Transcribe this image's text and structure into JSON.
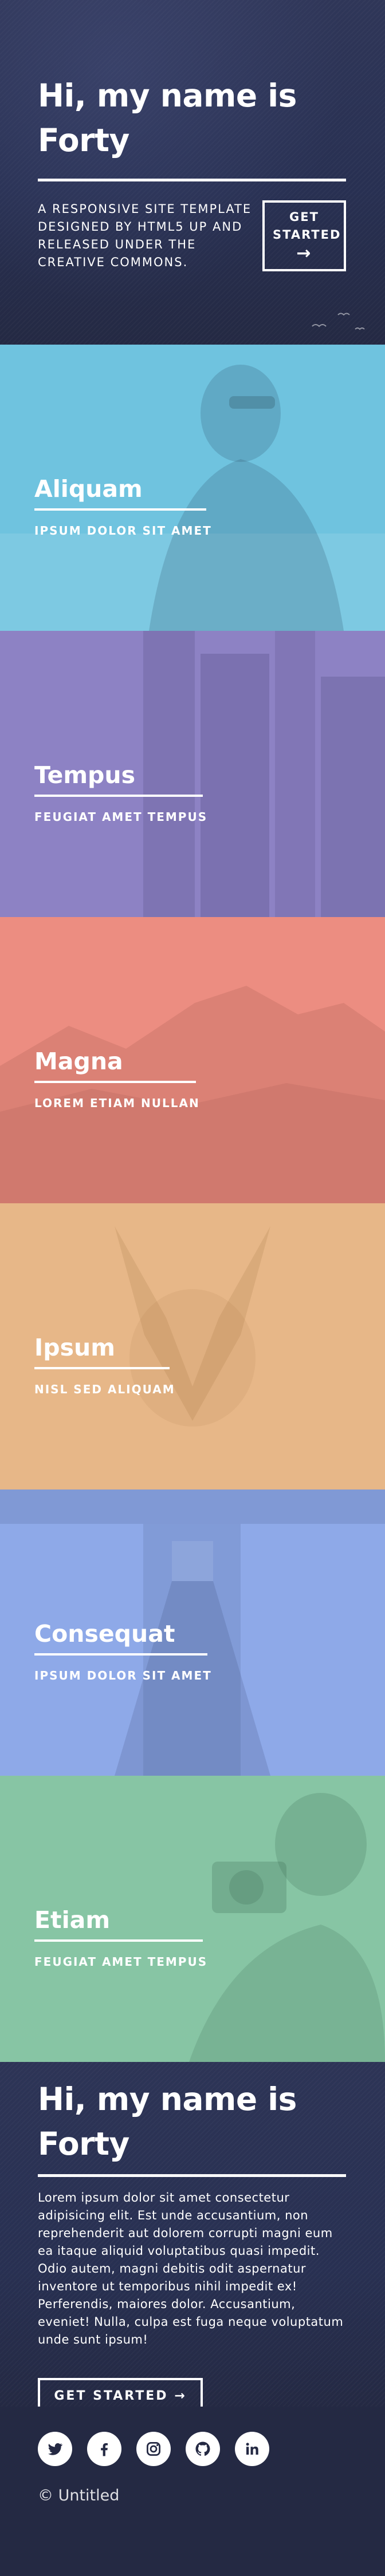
{
  "banner": {
    "title": "Hi, my name is Forty",
    "description": "A responsive site template designed by HTML5 UP and released under the Creative Commons.",
    "button_label": "GET STARTED",
    "button_arrow": "→"
  },
  "tiles": [
    {
      "title": "Aliquam",
      "subtitle": "IPSUM DOLOR SIT AMET",
      "color": "#6fc3df"
    },
    {
      "title": "Tempus",
      "subtitle": "FEUGIAT AMET TEMPUS",
      "color": "#8d82c4"
    },
    {
      "title": "Magna",
      "subtitle": "LOREM ETIAM NULLAN",
      "color": "#ec8d81"
    },
    {
      "title": "Ipsum",
      "subtitle": "NISL SED ALIQUAM",
      "color": "#e7b788"
    },
    {
      "title": "Consequat",
      "subtitle": "IPSUM DOLOR SIT AMET",
      "color": "#8ea9e8"
    },
    {
      "title": "Etiam",
      "subtitle": "FEUGIAT AMET TEMPUS",
      "color": "#87c5a4"
    }
  ],
  "contact": {
    "title": "Hi, my name is Forty",
    "paragraph": "Lorem ipsum dolor sit amet consectetur adipisicing elit. Est unde accusantium, non reprehenderit aut dolorem corrupti magni eum ea itaque aliquid voluptatibus quasi impedit. Odio autem, magni debitis odit aspernatur inventore ut temporibus nihil impedit ex! Perferendis, maiores dolor. Accusantium, eveniet! Nulla, culpa est fuga neque voluptatum unde sunt ipsum!",
    "button_label": "GET STARTED →"
  },
  "footer": {
    "socials": [
      {
        "name": "twitter-icon"
      },
      {
        "name": "facebook-icon"
      },
      {
        "name": "instagram-icon"
      },
      {
        "name": "github-icon"
      },
      {
        "name": "linkedin-icon"
      }
    ],
    "copyright": "© Untitled"
  },
  "colors": {
    "background": "#242943",
    "text": "#ffffff"
  }
}
